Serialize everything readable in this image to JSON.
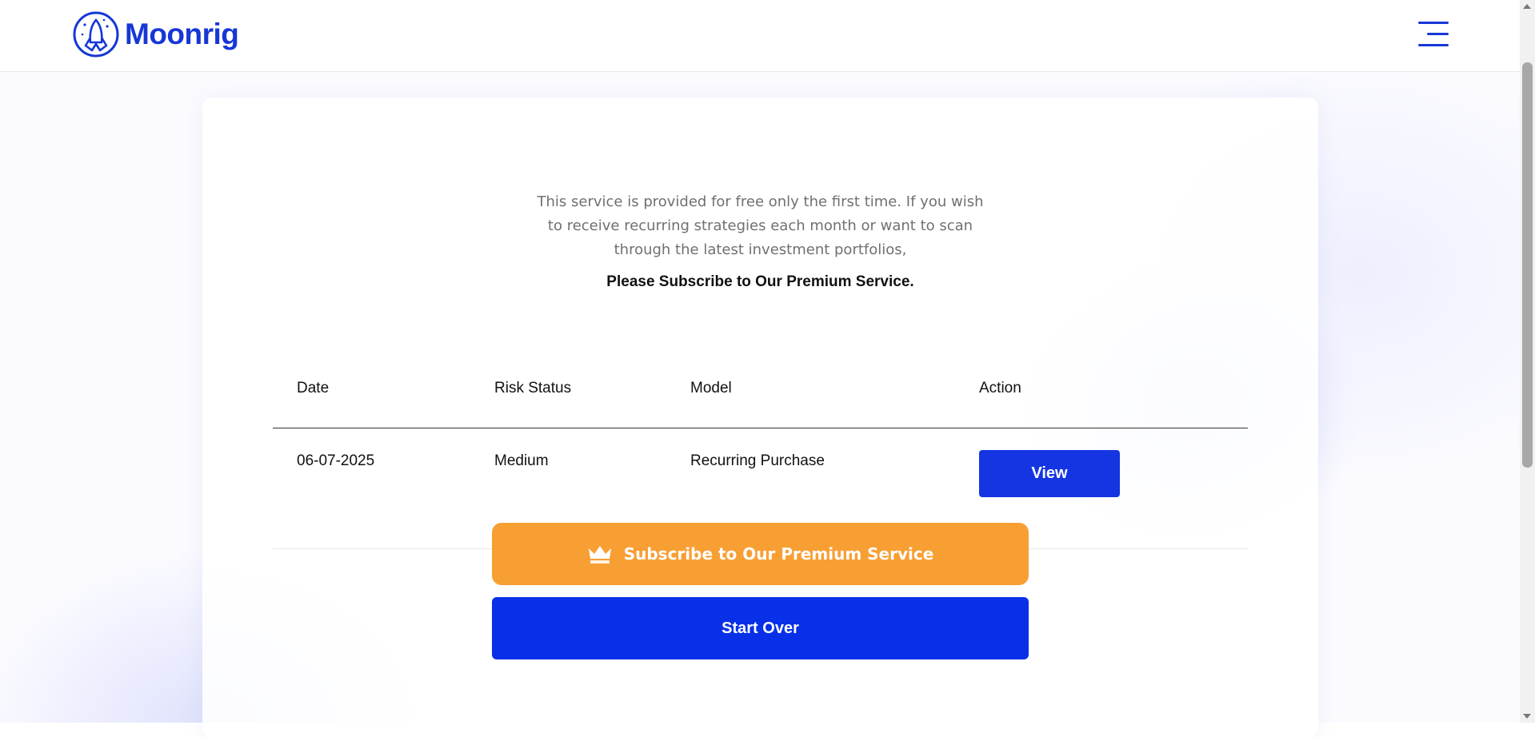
{
  "header": {
    "brand": "Moonrig",
    "logo_icon": "moonrig-rocket-logo-icon",
    "menu_icon": "hamburger-menu-icon"
  },
  "notice": {
    "text": "This service is provided for free only the first time. If you wish to receive recurring strategies each month or want to scan through the latest investment portfolios,",
    "cta": "Please Subscribe to Our Premium Service."
  },
  "table": {
    "headers": [
      "Date",
      "Risk Status",
      "Model",
      "Action"
    ],
    "rows": [
      {
        "date": "06-07-2025",
        "risk": "Medium",
        "model": "Recurring Purchase",
        "action": "View"
      }
    ]
  },
  "buttons": {
    "subscribe": "Subscribe to Our Premium Service",
    "subscribe_icon": "crown-icon",
    "start_over": "Start Over"
  },
  "colors": {
    "brand_blue": "#1637d6",
    "primary_button": "#0730e8",
    "subscribe_orange": "#f89f34"
  }
}
